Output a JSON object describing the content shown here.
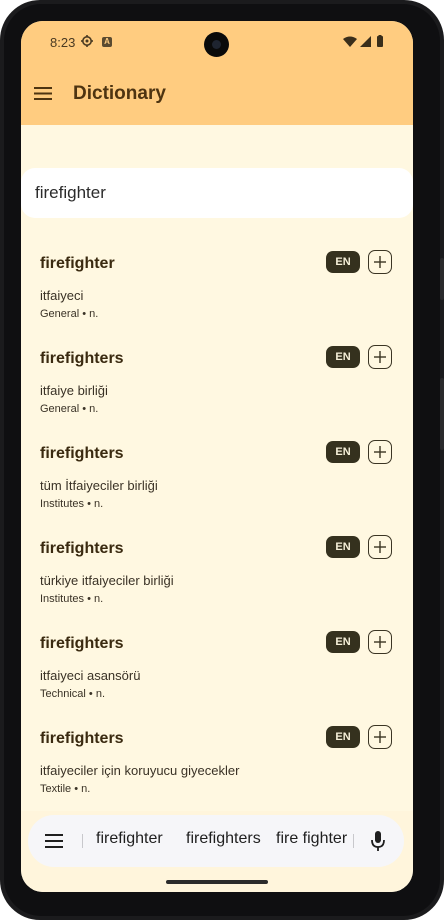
{
  "status": {
    "time": "8:23",
    "icons": [
      "gear-icon",
      "a-badge-icon",
      "wifi-icon",
      "signal-icon",
      "battery-icon"
    ]
  },
  "app": {
    "title": "Dictionary",
    "menu_icon": "menu-icon"
  },
  "search": {
    "value": "firefighter",
    "placeholder": ""
  },
  "results": [
    {
      "word": "firefighter",
      "translation": "itfaiyeci",
      "meta": "General • n.",
      "lang": "EN"
    },
    {
      "word": "firefighters",
      "translation": "itfaiye birliği",
      "meta": "General • n.",
      "lang": "EN"
    },
    {
      "word": "firefighters",
      "translation": "tüm İtfaiyeciler birliği",
      "meta": "Institutes • n.",
      "lang": "EN"
    },
    {
      "word": "firefighters",
      "translation": "türkiye itfaiyeciler birliği",
      "meta": "Institutes • n.",
      "lang": "EN"
    },
    {
      "word": "firefighters",
      "translation": "itfaiyeci asansörü",
      "meta": "Technical • n.",
      "lang": "EN"
    },
    {
      "word": "firefighters",
      "translation": "itfaiyeciler için koruyucu giyecekler",
      "meta": "Textile • n.",
      "lang": "EN"
    }
  ],
  "keyboard": {
    "suggestions": [
      "firefighter",
      "firefighters",
      "fire fighter"
    ]
  },
  "colors": {
    "app_bar": "#ffcc80",
    "background": "#fff8e1",
    "title": "#4e3411",
    "badge": "#35311e"
  }
}
